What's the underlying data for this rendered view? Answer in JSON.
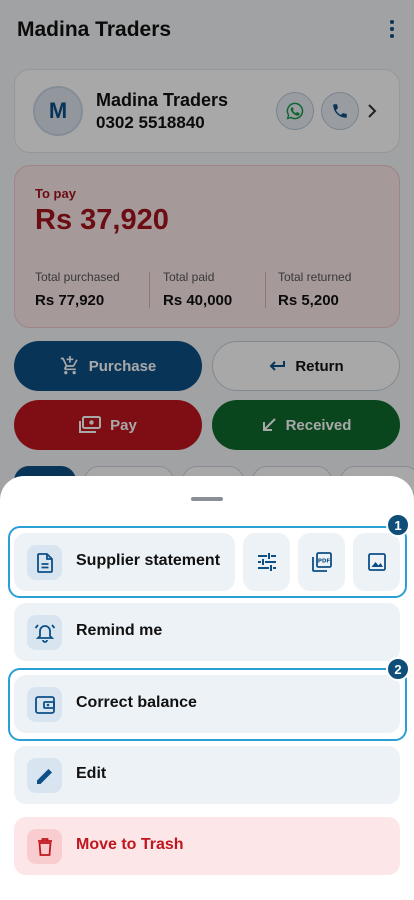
{
  "app": {
    "title": "Madina Traders"
  },
  "party": {
    "avatar_letter": "M",
    "name": "Madina Traders",
    "phone": "0302 5518840"
  },
  "balance": {
    "label": "To pay",
    "amount": "Rs 37,920",
    "stats": [
      {
        "label": "Total purchased",
        "value": "Rs 77,920"
      },
      {
        "label": "Total paid",
        "value": "Rs 40,000"
      },
      {
        "label": "Total returned",
        "value": "Rs 5,200"
      }
    ]
  },
  "actions": {
    "purchase": "Purchase",
    "return": "Return",
    "pay": "Pay",
    "received": "Received"
  },
  "sheet": {
    "items": [
      {
        "label": "Supplier statement",
        "icon": "document-icon"
      },
      {
        "label": "Remind me",
        "icon": "alarm-icon"
      },
      {
        "label": "Correct balance",
        "icon": "wallet-icon"
      },
      {
        "label": "Edit",
        "icon": "pencil-icon"
      },
      {
        "label": "Move to Trash",
        "icon": "trash-icon"
      }
    ],
    "statement_tools": [
      "filter-icon",
      "pdf-icon",
      "image-icon"
    ]
  },
  "highlights": [
    {
      "badge": "1"
    },
    {
      "badge": "2"
    }
  ],
  "colors": {
    "primary": "#0d4f86",
    "danger": "#c0161e",
    "success": "#0f6a2c",
    "highlight": "#2a9fd6"
  }
}
